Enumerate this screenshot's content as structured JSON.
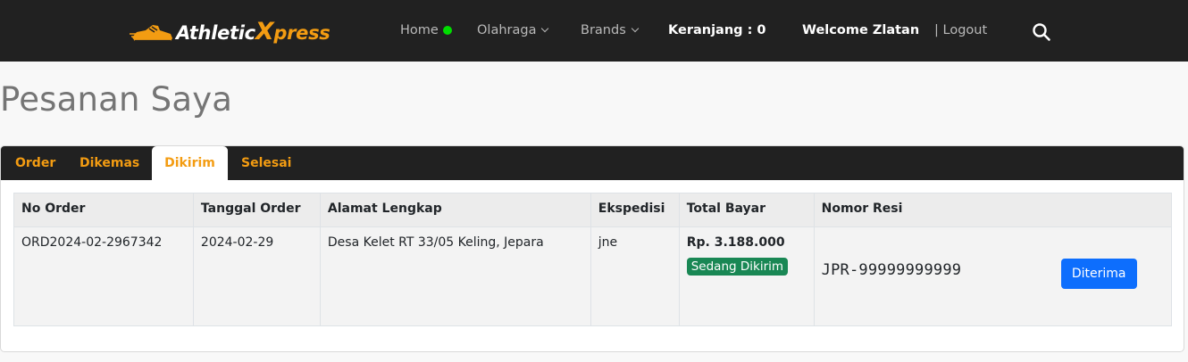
{
  "navbar": {
    "brand_main": "Athletic",
    "brand_x": "X",
    "brand_tail": "press",
    "home_label": "Home",
    "sports_label": "Olahraga",
    "brands_label": "Brands",
    "cart_label": "Keranjang : 0",
    "welcome_label": "Welcome Zlatan",
    "logout_label": "| Logout",
    "icons": [
      "shoe-logo-icon",
      "online-status-dot",
      "chevron-down-icon",
      "search-icon"
    ],
    "accent_color": "#f39c12",
    "status_color": "#00dd00"
  },
  "page": {
    "title": "Pesanan Saya"
  },
  "tabs": [
    {
      "label": "Order",
      "active": false
    },
    {
      "label": "Dikemas",
      "active": false
    },
    {
      "label": "Dikirim",
      "active": true
    },
    {
      "label": "Selesai",
      "active": false
    }
  ],
  "table": {
    "headers": [
      "No Order",
      "Tanggal Order",
      "Alamat Lengkap",
      "Ekspedisi",
      "Total Bayar",
      "Nomor Resi"
    ],
    "rows": [
      {
        "no_order": "ORD2024-02-2967342",
        "tanggal": "2024-02-29",
        "alamat": "Desa Kelet RT 33/05 Keling, Jepara",
        "ekspedisi": "jne",
        "total": "Rp. 3.188.000",
        "status": "Sedang Dikirim",
        "resi": "JPR-99999999999",
        "action_label": "Diterima"
      }
    ]
  }
}
